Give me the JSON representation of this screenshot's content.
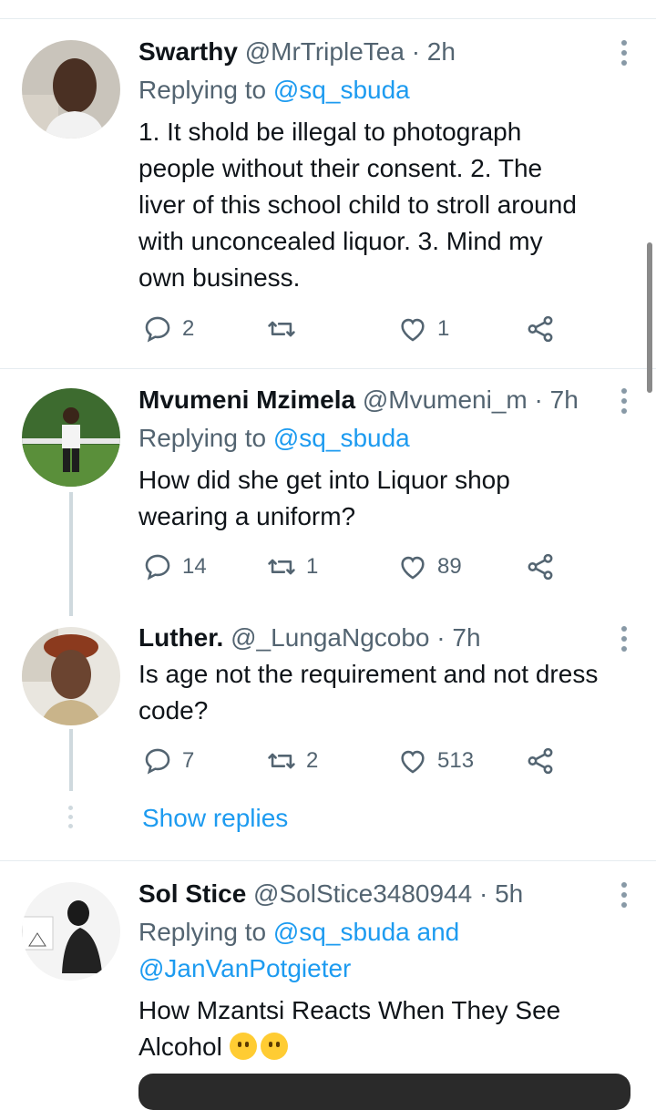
{
  "tweets": [
    {
      "name": "Swarthy",
      "handle": "@MrTripleTea",
      "time": "· 2h",
      "replying_prefix": "Replying to",
      "replying_to": "@sq_sbuda",
      "body_lines": [
        "1. It shold be illegal to photograph",
        "people without their consent. 2. The",
        "liver of this school child to stroll around",
        "with unconcealed liquor. 3. Mind my",
        "own business."
      ],
      "replies": "2",
      "retweets": "",
      "likes": "1"
    },
    {
      "name": "Mvumeni Mzimela",
      "handle": "@Mvumeni_m",
      "time": "· 7h",
      "replying_prefix": "Replying to",
      "replying_to": "@sq_sbuda",
      "body_lines": [
        "How did she get into Liquor shop",
        "wearing a uniform?"
      ],
      "replies": "14",
      "retweets": "1",
      "likes": "89"
    },
    {
      "name": "Luther.",
      "handle": "@_LungaNgcobo",
      "time": "· 7h",
      "body_lines": [
        "Is age not the requirement and not dress",
        "code?"
      ],
      "replies": "7",
      "retweets": "2",
      "likes": "513"
    },
    {
      "name": "Sol Stice",
      "handle": "@SolStice3480944",
      "time": "· 5h",
      "replying_prefix": "Replying to",
      "replying_to": "@sq_sbuda",
      "replying_and": "and",
      "replying_to_2": "@JanVanPotgieter",
      "body_lines": [
        "How Mzantsi Reacts When They See",
        "Alcohol"
      ]
    }
  ],
  "show_replies": "Show replies",
  "icons": {
    "reply": "reply-bubble-icon",
    "retweet": "retweet-icon",
    "like": "heart-icon",
    "share": "share-icon",
    "more": "more-vertical-icon",
    "emoji": "slightly-smiling-face-emoji"
  },
  "colors": {
    "link": "#1d9bf0",
    "secondary_text": "#536471",
    "divider": "#e6ecf0"
  }
}
